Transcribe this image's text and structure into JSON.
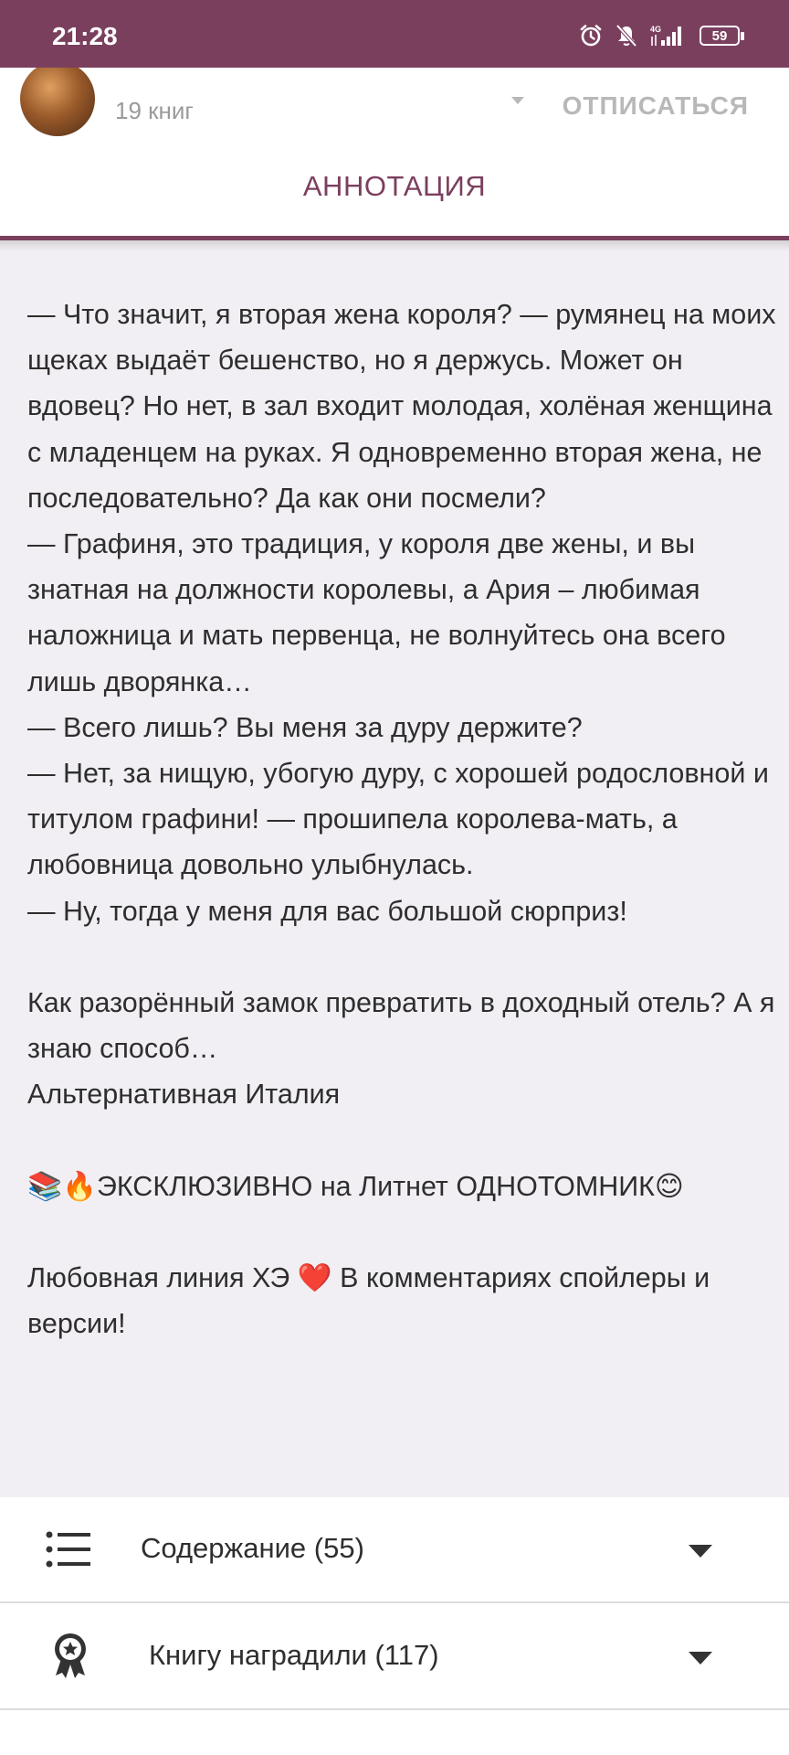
{
  "status_bar": {
    "time": "21:28",
    "battery": "59",
    "icons": [
      "alarm-icon",
      "mute-icon",
      "signal-4g-icon",
      "battery-icon"
    ]
  },
  "author": {
    "books_count": "19 книг",
    "subscribe_label": "ОТПИСАТЬСЯ"
  },
  "tabs": {
    "annotation_label": "АННОТАЦИЯ"
  },
  "annotation": {
    "paragraphs": [
      "— Что значит, я вторая жена короля? — румянец на моих щеках выдаёт бешенство, но я держусь. Может он вдовец? Но нет, в зал входит молодая, холёная женщина с младенцем на руках. Я одновременно вторая жена, не последовательно? Да как они посмели?",
      "— Графиня, это традиция, у короля две жены, и вы знатная на должности королевы, а Ария – любимая наложница и мать первенца, не волнуйтесь она всего лишь дворянка…",
      "— Всего лишь? Вы меня за дуру держите?",
      "— Нет, за нищую, убогую дуру, с хорошей родословной и титулом графини! — прошипела королева-мать, а любовница довольно улыбнулась.",
      "— Ну, тогда у меня для вас большой сюрприз!",
      "",
      "Как разорённый замок превратить в доходный отель? А я знаю способ…",
      "Альтернативная Италия",
      "",
      "📚🔥ЭКСКЛЮЗИВНО на Литнет ОДНОТОМНИК😊",
      "",
      "Любовная линия ХЭ ❤️ В комментариях спойлеры и версии!"
    ]
  },
  "sections": {
    "contents_label": "Содержание (55)",
    "awards_label": "Книгу наградили (117)"
  },
  "colors": {
    "accent": "#7b3f5e",
    "annotation_bg": "#f1eff3",
    "text": "#2e2e2e"
  }
}
